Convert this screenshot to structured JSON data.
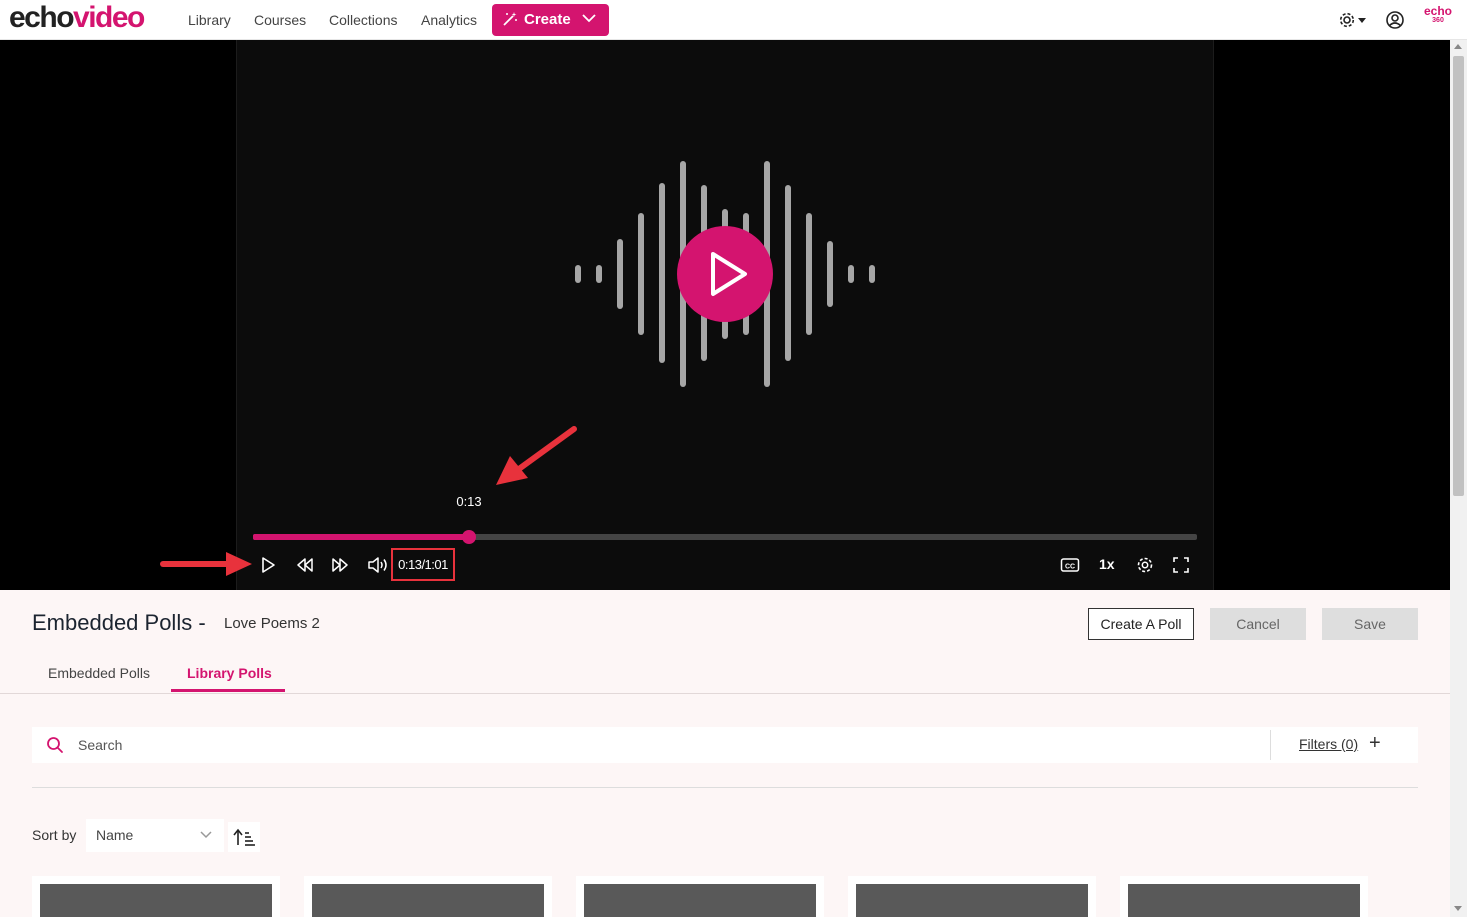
{
  "brand": {
    "echo": "echo",
    "video": "video",
    "small_logo": "echo",
    "small_logo_sub": "360"
  },
  "nav": {
    "items": [
      "Library",
      "Courses",
      "Collections",
      "Analytics"
    ],
    "create_label": "Create"
  },
  "player": {
    "hover_time": "0:13",
    "time_display": "0:13/1:01",
    "speed": "1x",
    "progress": 0.229
  },
  "panel": {
    "title": "Embedded Polls -",
    "subtitle": "Love Poems 2",
    "buttons": {
      "create_poll": "Create A Poll",
      "cancel": "Cancel",
      "save": "Save"
    },
    "tabs": [
      {
        "label": "Embedded Polls",
        "active": false
      },
      {
        "label": "Library Polls",
        "active": true
      }
    ],
    "search_placeholder": "Search",
    "filters_label": "Filters (0)",
    "sort_label": "Sort by",
    "sort_value": "Name"
  },
  "colors": {
    "accent": "#d4146f",
    "annotation": "#e8323c"
  }
}
